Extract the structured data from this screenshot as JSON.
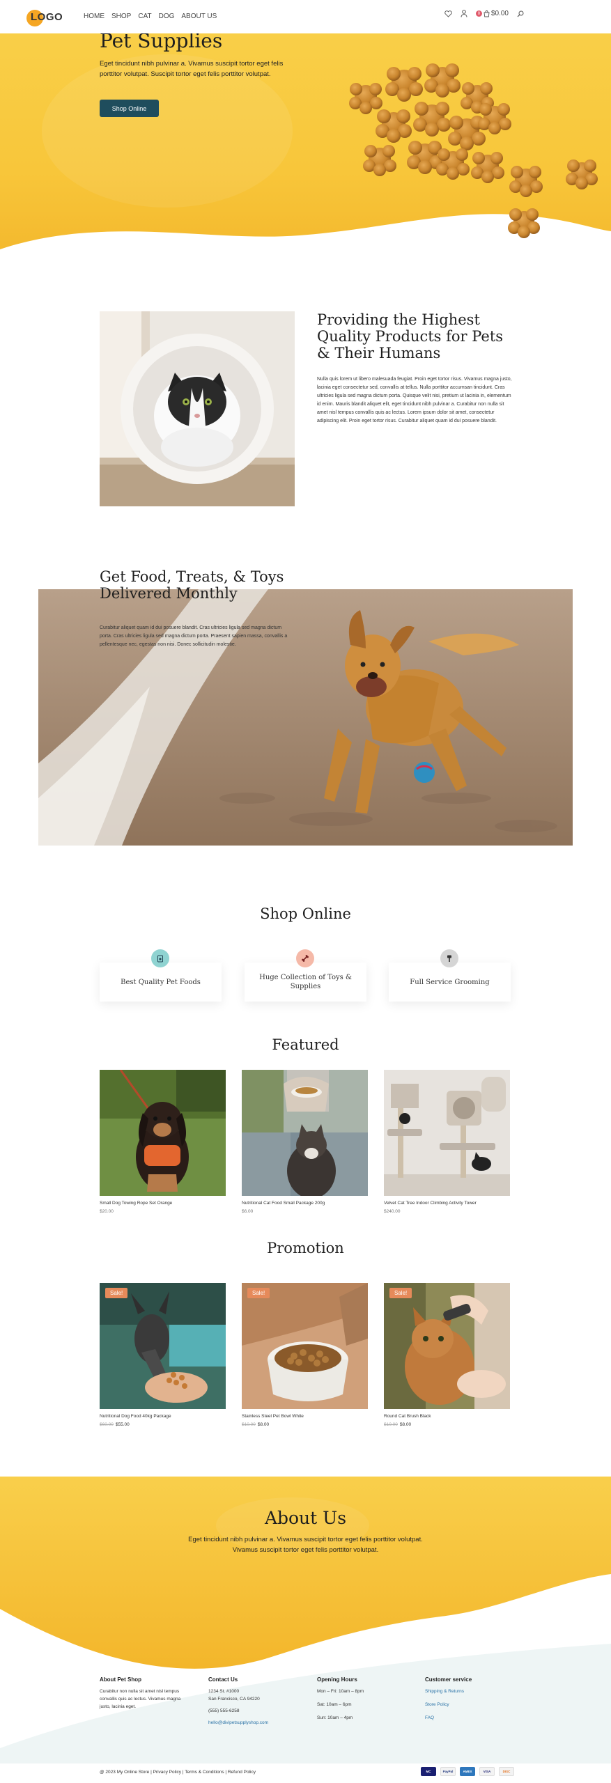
{
  "header": {
    "logo_text": "LOGO",
    "nav": [
      "HOME",
      "SHOP",
      "CAT",
      "DOG",
      "ABOUT US"
    ],
    "cart_count": "0",
    "cart_total": "$0.00",
    "icons": [
      "heart-icon",
      "user-icon",
      "cart-icon",
      "search-icon"
    ]
  },
  "hero": {
    "title": "Pet Supplies",
    "text": "Eget tincidunt nibh pulvinar a. Vivamus suscipit tortor eget felis porttitor volutpat. Suscipit tortor eget felis porttitor volutpat.",
    "button": "Shop Online"
  },
  "providing": {
    "title": "Providing the Highest Quality Products for Pets & Their Humans",
    "text": "Nulla quis lorem ut libero malesuada feugiat. Proin eget tortor risus. Vivamus magna justo, lacinia eget consectetur sed, convallis at tellus. Nulla porttitor accumsan tincidunt. Cras ultricies ligula sed magna dictum porta. Quisque velit nisi, pretium ut lacinia in, elementum id enim. Mauris blandit aliquet elit, eget tincidunt nibh pulvinar a. Curabitur non nulla sit amet nisl tempus convallis quis ac lectus. Lorem ipsum dolor sit amet, consectetur adipiscing elit. Proin eget tortor risus. Curabitur aliquet quam id dui posuere blandit."
  },
  "food": {
    "title": "Get Food, Treats, & Toys Delivered Monthly",
    "text": "Curabitur aliquet quam id dui posuere blandit. Cras ultricies ligula sed magna dictum porta. Cras ultricies ligula sed magna dictum porta. Praesent sapien massa, convallis a pellentesque nec, egestas non nisi. Donec sollicitudin molestie."
  },
  "shop_online": {
    "title": "Shop Online",
    "features": [
      {
        "label": "Best Quality Pet Foods",
        "icon": "food-bag-icon",
        "color": "#8fd3d1"
      },
      {
        "label": "Huge Collection of Toys & Supplies",
        "icon": "bone-toy-icon",
        "color": "#f5b9a8"
      },
      {
        "label": "Full Service Grooming",
        "icon": "grooming-brush-icon",
        "color": "#d5d5d5"
      }
    ]
  },
  "featured": {
    "title": "Featured",
    "products": [
      {
        "name": "Small Dog Towing Rope Set Orange",
        "price": "$20.00"
      },
      {
        "name": "Nutritional Cat Food Small Package 200g",
        "price": "$6.00"
      },
      {
        "name": "Velvet Cat Tree Indoor Climbing Activity Tower",
        "price": "$240.00"
      }
    ]
  },
  "promotion": {
    "title": "Promotion",
    "sale_label": "Sale!",
    "products": [
      {
        "name": "Nutritional Dog Food 40kg Package",
        "old_price": "$60.00",
        "price": "$55.00"
      },
      {
        "name": "Stainless Steel Pet Bowl White",
        "old_price": "$10.00",
        "price": "$8.00"
      },
      {
        "name": "Round Cat Brush Black",
        "old_price": "$10.00",
        "price": "$8.00"
      }
    ]
  },
  "about": {
    "title": "About Us",
    "text": "Eget tincidunt nibh pulvinar a. Vivamus suscipit tortor eget felis porttitor volutpat. Vivamus suscipit tortor eget felis porttitor volutpat."
  },
  "footer": {
    "about_title": "About Pet Shop",
    "about_text": "Curabitur non nulla sit amet nisl tempus convallis quis ac lectus. Vivamus magna justo, lacinia eget.",
    "contact_title": "Contact Us",
    "address1": "1234 St. #1000",
    "address2": "San Francisco, CA 94220",
    "phone": "(555) 555-6258",
    "email": "hello@divipetsupplyshop.com",
    "hours_title": "Opening Hours",
    "hours": [
      "Mon – Fri: 10am – 8pm",
      "Sat: 10am – 6pm",
      "Sun: 10am – 4pm"
    ],
    "service_title": "Customer service",
    "service_links": [
      "Shipping & Returns",
      "Store Policy",
      "FAQ"
    ],
    "copyright": "@ 2023 My Online Store | Privacy Policy | Terms & Conditions | Refund Policy",
    "payments": [
      "MC",
      "PayPal",
      "AMEX",
      "VISA",
      "DISC"
    ]
  },
  "colors": {
    "hero_yellow": "#f8c63a",
    "button_dark": "#1f4d5d",
    "sale_orange": "#e68a5a",
    "link_blue": "#2a72a6"
  }
}
